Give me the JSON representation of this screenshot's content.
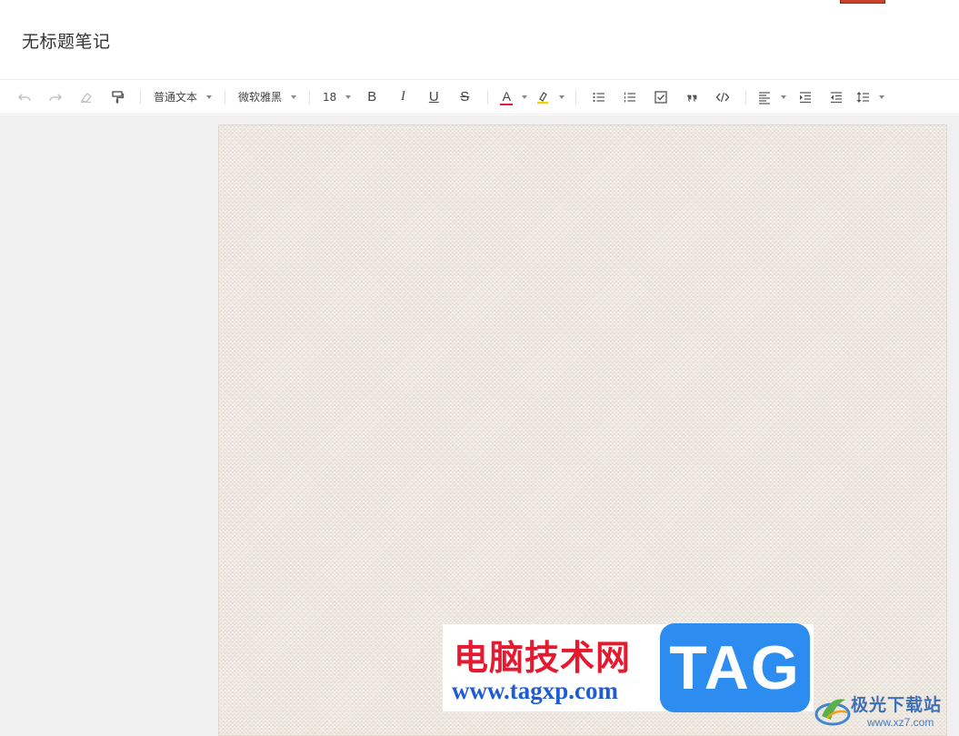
{
  "header": {
    "title": "无标题笔记"
  },
  "toolbar": {
    "style_dropdown": "普通文本",
    "font_dropdown": "微软雅黑",
    "size_dropdown": "18",
    "bold": "B",
    "italic": "I",
    "underline": "U",
    "strike": "S",
    "font_color_label": "A",
    "font_color": "#e5192f",
    "highlight_color": "#f5d000"
  },
  "watermark": {
    "title": "电脑技术网",
    "url": "www.tagxp.com",
    "tag": "TAG",
    "site_name": "极光下载站",
    "site_url": "www.xz7.com"
  }
}
